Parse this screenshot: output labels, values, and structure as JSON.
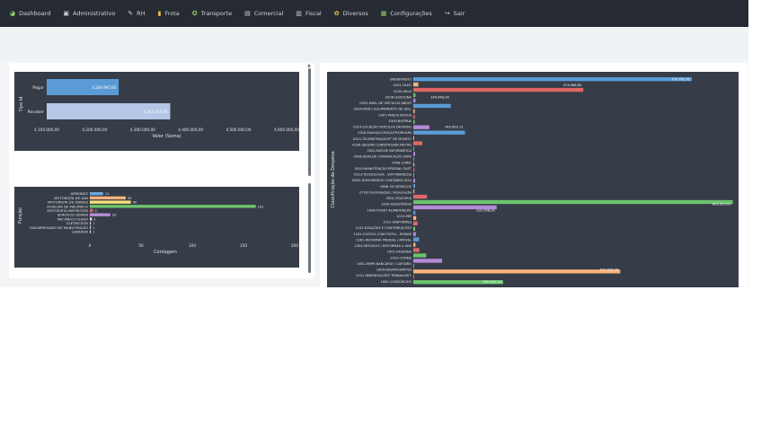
{
  "nav": {
    "items": [
      {
        "label": "Dashboard",
        "icon": "dashboard-icon",
        "glyph": "◕",
        "color": "#8fd16b"
      },
      {
        "label": "Administrativo",
        "icon": "admin-icon",
        "glyph": "▣",
        "color": "#cfd3d8"
      },
      {
        "label": "RH",
        "icon": "rh-icon",
        "glyph": "✎",
        "color": "#cfd3d8"
      },
      {
        "label": "Frota",
        "icon": "frota-icon",
        "glyph": "▮",
        "color": "#f0c040"
      },
      {
        "label": "Transporte",
        "icon": "transporte-icon",
        "glyph": "✪",
        "color": "#8fd16b"
      },
      {
        "label": "Comercial",
        "icon": "comercial-icon",
        "glyph": "▤",
        "color": "#cfd3d8"
      },
      {
        "label": "Fiscal",
        "icon": "fiscal-icon",
        "glyph": "▥",
        "color": "#cfd3d8"
      },
      {
        "label": "Diversos",
        "icon": "diversos-icon",
        "glyph": "✿",
        "color": "#f0c040"
      },
      {
        "label": "Configurações",
        "icon": "configuracoes-icon",
        "glyph": "▦",
        "color": "#8fd16b"
      },
      {
        "label": "Sair",
        "icon": "sair-icon",
        "glyph": "↪",
        "color": "#cfd3d8"
      }
    ]
  },
  "chart_data": [
    {
      "type": "bar",
      "orientation": "horizontal",
      "categories": [
        "Pagar",
        "Receber"
      ],
      "values": [
        4249997,
        4357457
      ],
      "data_labels": [
        "4.249.997,00",
        "4.357.457,00"
      ],
      "colors": [
        "#5b9bd5",
        "#b4c7e7"
      ],
      "xlim": [
        4100000,
        4600000
      ],
      "xticks": [
        "4.100.000,00",
        "4.200.000,00",
        "4.300.000,00",
        "4.400.000,00",
        "4.500.000,00",
        "4.600.000,00"
      ],
      "xlabel": "Valor (Soma)",
      "ylabel": "Tipo Id"
    },
    {
      "type": "bar",
      "orientation": "horizontal",
      "categories": [
        "APRENDIZ",
        "MOTORISTA DE VAN",
        "MOTORISTA DE ÔNIBUS",
        "AUXILIAR DE MECÂNICO",
        "MOTORISTA INSTRUTOR",
        "SERVIÇOS GERAIS",
        "MECÂNICO PLENO",
        "ELETRICISTA",
        "ENCARREGADO DE MANUTENÇÃO",
        "LAVADOR"
      ],
      "values": [
        13,
        35,
        40,
        162,
        3,
        20,
        2,
        1,
        1,
        1
      ],
      "data_labels": [
        "13",
        "35",
        "40",
        "162",
        "3",
        "20",
        "2",
        "1",
        "1",
        "1"
      ],
      "colors": [
        "#6fa8dc",
        "#f9b27a",
        "#f6e27a",
        "#6cc36c",
        "#e06666",
        "#b58ad8",
        "#d9d9d9",
        "#d9d9d9",
        "#d9d9d9",
        "#d9d9d9"
      ],
      "xlim": [
        0,
        200
      ],
      "xticks": [
        "0",
        "50",
        "100",
        "150",
        "200"
      ],
      "xlabel": "Contagem",
      "ylabel": "Função"
    },
    {
      "type": "bar",
      "orientation": "horizontal",
      "ylabel": "Classificação de Despesa",
      "categories": [
        "(INDEFINIDO)",
        "0201-ÓLEO",
        "0209-ARLA",
        "0208-GASOLINA",
        "0303-MAN. DE VEÍCULOS ABOIO",
        "0304-MAN / EQUIPAMENTO DE SEG.",
        "0307-PNEUS NOVOS",
        "0309-BATERIA",
        "0314-LOCAÇÃO VEÍCULOS (NOVIDA)",
        "0316-TAXAS/LICENÇA/TRF/ROAPA",
        "0321-TELEMETRIA/SOFT DE MONITO",
        "0326-SEGURO (SINISTRO/DR.FROTA)",
        "0502-MAT.DE INFORMÁTICA",
        "0506-SERV.DE COMUNICAÇÃO DATA",
        "0508-CORR.",
        "0510-MANUTENÇÃO PREDIAL FILET",
        "0513-TECNOLOGIA - SOFTWARE/SIS",
        "0602-HONORÁRIOS CONTÁBEIS (RO)",
        "0608-ÓS SERVIÇOS",
        "0703-Contratações / Associação",
        "0901-ROZOPHS",
        "1005-ASSISTÊNCIA",
        "1006-TICKET ALIMENTAÇÃO",
        "1013-MEI",
        "1021-UNIFORMES",
        "1102-DOAÇÕES E CONTRIBUIÇÕES",
        "1202-CUSTOS COM FROTA - ROMAR",
        "1261-REFORMA PREDIAL / IMÓVEL",
        "1304-VEÍCULOS / REFORMAS e ADE",
        "1401-FAZENDA",
        "1502-COFINS",
        "1601-EMPR.BANCÁRIO / CAP.GIRO",
        "1609-DESPACHANTES",
        "0101-INDENIZAÇÕES TRABALHIST.",
        "1602-CONSÓRCIOS"
      ],
      "values": [
        774761,
        14000,
        473066,
        6000,
        6000,
        104443,
        4000,
        4000,
        4000,
        45000,
        143929,
        2000,
        25000,
        2000,
        5000,
        1000,
        3000,
        3000,
        1000,
        5000,
        5000,
        3000,
        38000,
        889000,
        232000,
        6000,
        8000,
        12000,
        5000,
        7000,
        16000,
        6000,
        17000,
        36000,
        80000,
        1000,
        575939,
        2000,
        250000
      ],
      "labeled_values": [
        {
          "category": "(INDEFINIDO)",
          "label": "774.761,91"
        },
        {
          "category": "0201-ÓLEO",
          "label": "473.066,63"
        },
        {
          "category": "0208-GASOLINA",
          "label": "104.443,24"
        },
        {
          "category": "0314-LOCAÇÃO VEÍCULOS (NOVIDA)",
          "label": "143.929,11"
        },
        {
          "category": "1005-ASSISTÊNCIA",
          "label": "889.000,00"
        },
        {
          "category": "1006-TICKET ALIMENTAÇÃO",
          "label": "232.098,00"
        },
        {
          "category": "1609-DESPACHANTES",
          "label": "575.939,36"
        },
        {
          "category": "1602-CONSÓRCIOS",
          "label": "250.947,24"
        }
      ],
      "colors": [
        "#5b9bd5",
        "#f9b27a",
        "#e06666",
        "#6cc36c",
        "#b58ad8"
      ]
    }
  ]
}
